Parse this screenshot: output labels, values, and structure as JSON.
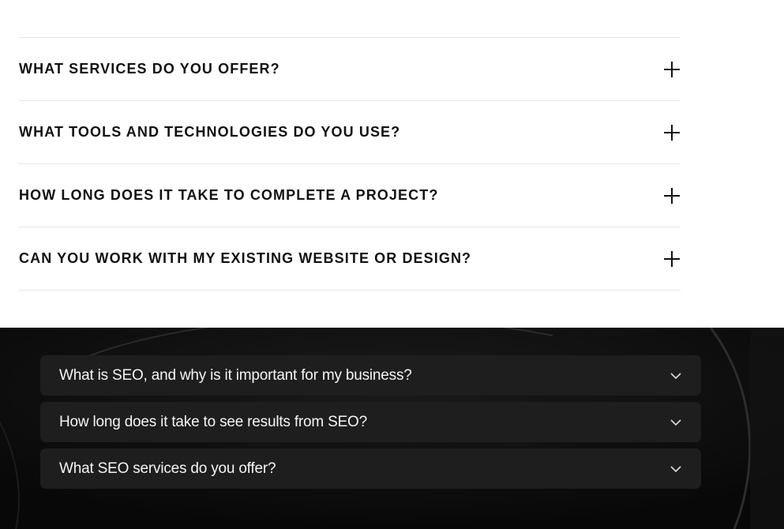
{
  "faq": {
    "items": [
      {
        "question": "WHAT SERVICES DO YOU OFFER?",
        "icon": "plus-icon"
      },
      {
        "question": "WHAT TOOLS AND TECHNOLOGIES DO YOU USE?",
        "icon": "plus-icon"
      },
      {
        "question": "HOW LONG DOES IT TAKE TO COMPLETE A PROJECT?",
        "icon": "plus-icon"
      },
      {
        "question": "CAN YOU WORK WITH MY EXISTING WEBSITE OR DESIGN?",
        "icon": "plus-icon"
      }
    ]
  },
  "seo_faq": {
    "items": [
      {
        "question": "What is SEO, and why is it important for my business?",
        "icon": "chevron-down-icon"
      },
      {
        "question": "How long does it take to see results from SEO?",
        "icon": "chevron-down-icon"
      },
      {
        "question": "What SEO services do you offer?",
        "icon": "chevron-down-icon"
      }
    ]
  },
  "colors": {
    "light_background": "#ffffff",
    "dark_background": "#0e0e0e",
    "dark_card": "#1e1e1e",
    "divider": "#e6e6e6",
    "text_dark": "#111111",
    "text_light": "#f5f5f5"
  }
}
